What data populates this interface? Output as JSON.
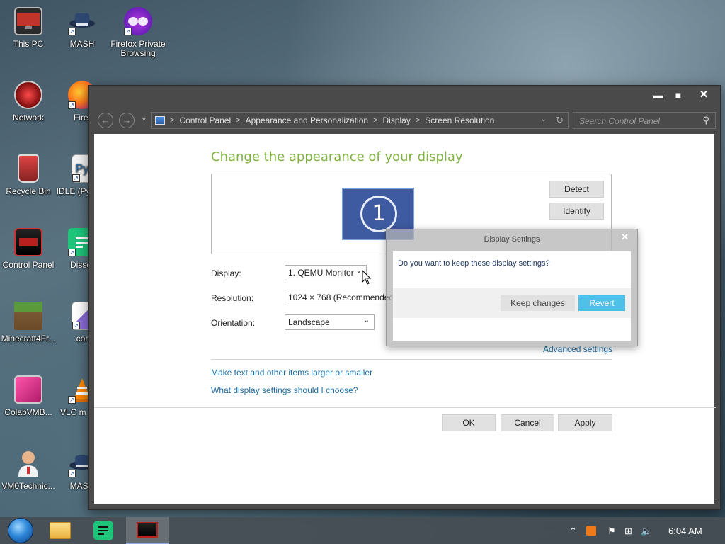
{
  "desktop": {
    "icons": [
      {
        "label": "This PC"
      },
      {
        "label": "MASH"
      },
      {
        "label": "Firefox Private Browsing"
      },
      {
        "label": "Network"
      },
      {
        "label": "Firef"
      },
      {
        "label": "Recycle Bin"
      },
      {
        "label": "IDLE (Py GUI"
      },
      {
        "label": "Control Panel"
      },
      {
        "label": "Disser"
      },
      {
        "label": "Minecraft4Fr..."
      },
      {
        "label": "cor"
      },
      {
        "label": "ColabVMB..."
      },
      {
        "label": "VLC m play"
      },
      {
        "label": "VM0Technic..."
      },
      {
        "label": "MASH"
      }
    ]
  },
  "window": {
    "controls": {
      "minimize": "▬",
      "maximize": "■",
      "close": "✕"
    },
    "address": {
      "crumbs": [
        "Control Panel",
        "Appearance and Personalization",
        "Display",
        "Screen Resolution"
      ],
      "separator": ">"
    },
    "search": {
      "placeholder": "Search Control Panel"
    },
    "heading": "Change the appearance of your display",
    "monitor_number": "1",
    "detect_label": "Detect",
    "identify_label": "Identify",
    "display": {
      "label": "Display:",
      "value": "1. QEMU Monitor"
    },
    "resolution": {
      "label": "Resolution:",
      "value": "1024 × 768 (Recommended)"
    },
    "orientation": {
      "label": "Orientation:",
      "value": "Landscape"
    },
    "advanced_link": "Advanced settings",
    "links": [
      "Make text and other items larger or smaller",
      "What display settings should I choose?"
    ],
    "ok_label": "OK",
    "cancel_label": "Cancel",
    "apply_label": "Apply"
  },
  "dialog": {
    "title": "Display Settings",
    "close": "✕",
    "message": "Do you want to keep these display settings?",
    "keep_label": "Keep changes",
    "revert_label": "Revert"
  },
  "taskbar": {
    "time": "6:04 AM"
  },
  "colors": {
    "heading": "#7fb241",
    "link": "#1c6ea4",
    "revert_bg": "#4fc0e8",
    "window_chrome": "#4a4a4a"
  }
}
